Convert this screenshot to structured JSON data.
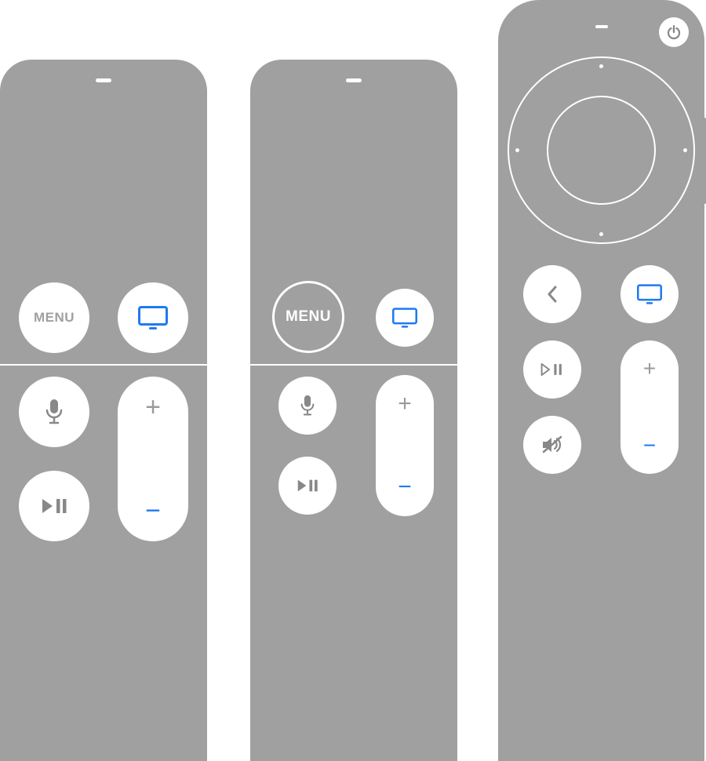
{
  "colors": {
    "accent": "#1e7bf0",
    "body": "#a0a0a0",
    "glyph_muted": "#9a9a9a",
    "white": "#ffffff"
  },
  "remotes": {
    "a": {
      "menu_label": "MENU"
    },
    "b": {
      "menu_label": "MENU"
    },
    "c": {}
  },
  "icons": {
    "tv": "tv-icon",
    "mic": "microphone-icon",
    "play_pause": "play-pause-icon",
    "plus": "plus-icon",
    "minus": "minus-icon",
    "power": "power-icon",
    "back": "chevron-left-icon",
    "mute": "speaker-mute-icon"
  },
  "glyphs": {
    "plus": "+",
    "minus": "−"
  }
}
